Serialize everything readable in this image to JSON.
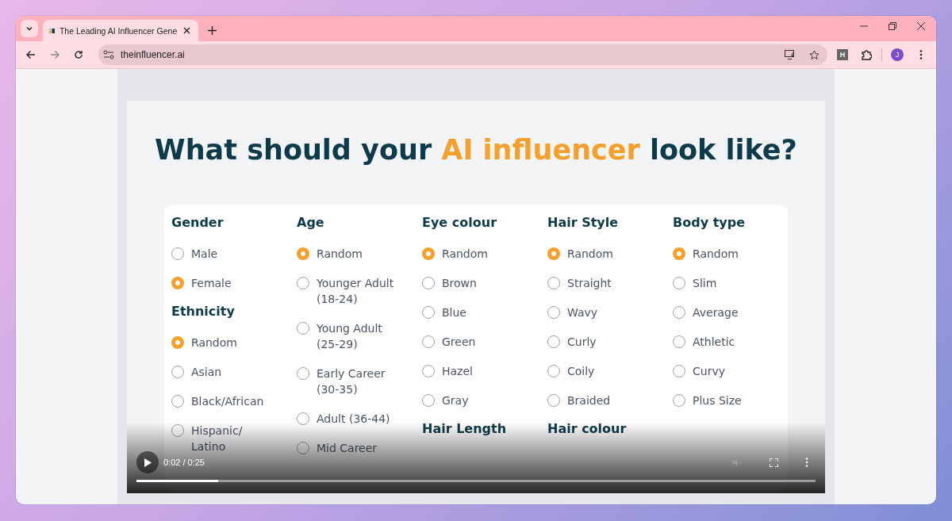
{
  "browser": {
    "tab_title": "The Leading AI Influencer Gene",
    "url": "theinfluencer.ai",
    "profile_initial": "J",
    "extension_letter": "H"
  },
  "page": {
    "title": {
      "before": "What should your ",
      "highlight": "AI influencer",
      "after": " look like?"
    },
    "columns": [
      {
        "groups": [
          {
            "heading": "Gender",
            "options": [
              {
                "label": "Male",
                "selected": false
              },
              {
                "label": "Female",
                "selected": true
              }
            ]
          },
          {
            "heading": "Ethnicity",
            "options": [
              {
                "label": "Random",
                "selected": true
              },
              {
                "label": "Asian",
                "selected": false
              },
              {
                "label": "Black/African",
                "selected": false
              },
              {
                "label": "Hispanic/ Latino",
                "selected": false
              }
            ]
          }
        ]
      },
      {
        "groups": [
          {
            "heading": "Age",
            "options": [
              {
                "label": "Random",
                "selected": true
              },
              {
                "label": "Younger Adult (18-24)",
                "selected": false
              },
              {
                "label": "Young Adult (25-29)",
                "selected": false
              },
              {
                "label": "Early Career (30-35)",
                "selected": false
              },
              {
                "label": "Adult (36-44)",
                "selected": false
              },
              {
                "label": "Mid Career",
                "selected": false
              }
            ]
          }
        ]
      },
      {
        "groups": [
          {
            "heading": "Eye colour",
            "options": [
              {
                "label": "Random",
                "selected": true
              },
              {
                "label": "Brown",
                "selected": false
              },
              {
                "label": "Blue",
                "selected": false
              },
              {
                "label": "Green",
                "selected": false
              },
              {
                "label": "Hazel",
                "selected": false
              },
              {
                "label": "Gray",
                "selected": false
              }
            ]
          },
          {
            "heading": "Hair Length"
          }
        ]
      },
      {
        "groups": [
          {
            "heading": "Hair Style",
            "options": [
              {
                "label": "Random",
                "selected": true
              },
              {
                "label": "Straight",
                "selected": false
              },
              {
                "label": "Wavy",
                "selected": false
              },
              {
                "label": "Curly",
                "selected": false
              },
              {
                "label": "Coily",
                "selected": false
              },
              {
                "label": "Braided",
                "selected": false
              }
            ]
          },
          {
            "heading": "Hair colour"
          }
        ]
      },
      {
        "groups": [
          {
            "heading": "Body type",
            "options": [
              {
                "label": "Random",
                "selected": true
              },
              {
                "label": "Slim",
                "selected": false
              },
              {
                "label": "Average",
                "selected": false
              },
              {
                "label": "Athletic",
                "selected": false
              },
              {
                "label": "Curvy",
                "selected": false
              },
              {
                "label": "Plus Size",
                "selected": false
              }
            ]
          }
        ]
      }
    ]
  },
  "video": {
    "time": "0:02 / 0:25",
    "level": 0.12
  }
}
